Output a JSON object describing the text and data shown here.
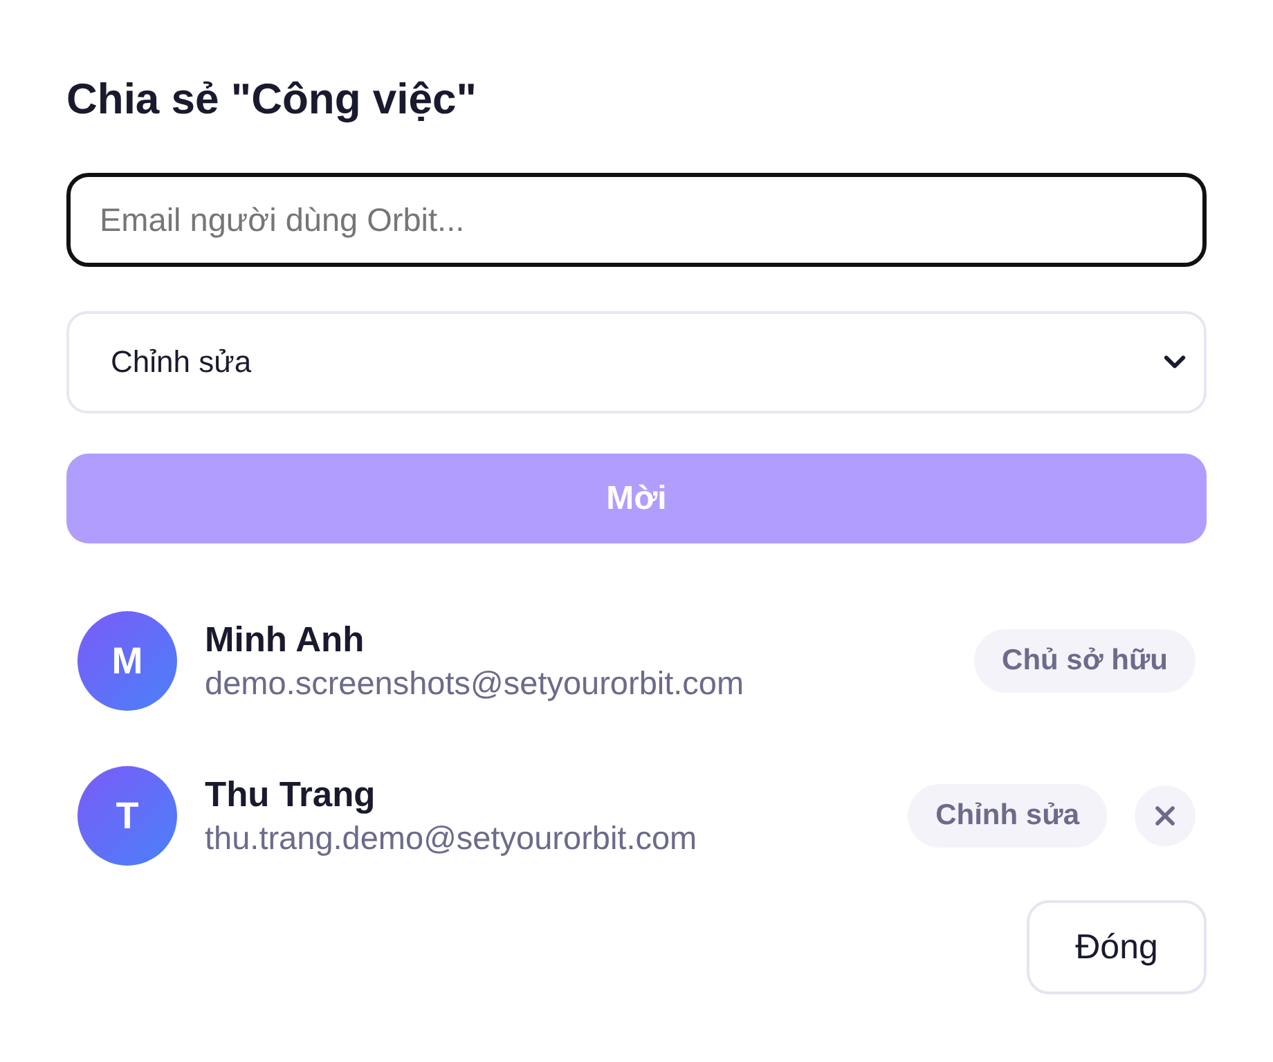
{
  "dialog": {
    "title": "Chia sẻ \"Công việc\"",
    "email_field": {
      "placeholder": "Email người dùng Orbit..."
    },
    "role_select": {
      "value": "Chỉnh sửa"
    },
    "invite_button": {
      "label": "Mời",
      "disabled": true
    },
    "members": [
      {
        "initial": "M",
        "name": "Minh Anh",
        "email": "demo.screenshots@setyourorbit.com",
        "role": "Chủ sở hữu",
        "removable": false
      },
      {
        "initial": "T",
        "name": "Thu Trang",
        "email": "thu.trang.demo@setyourorbit.com",
        "role": "Chỉnh sửa",
        "removable": true
      }
    ],
    "close_button": {
      "label": "Đóng"
    }
  }
}
